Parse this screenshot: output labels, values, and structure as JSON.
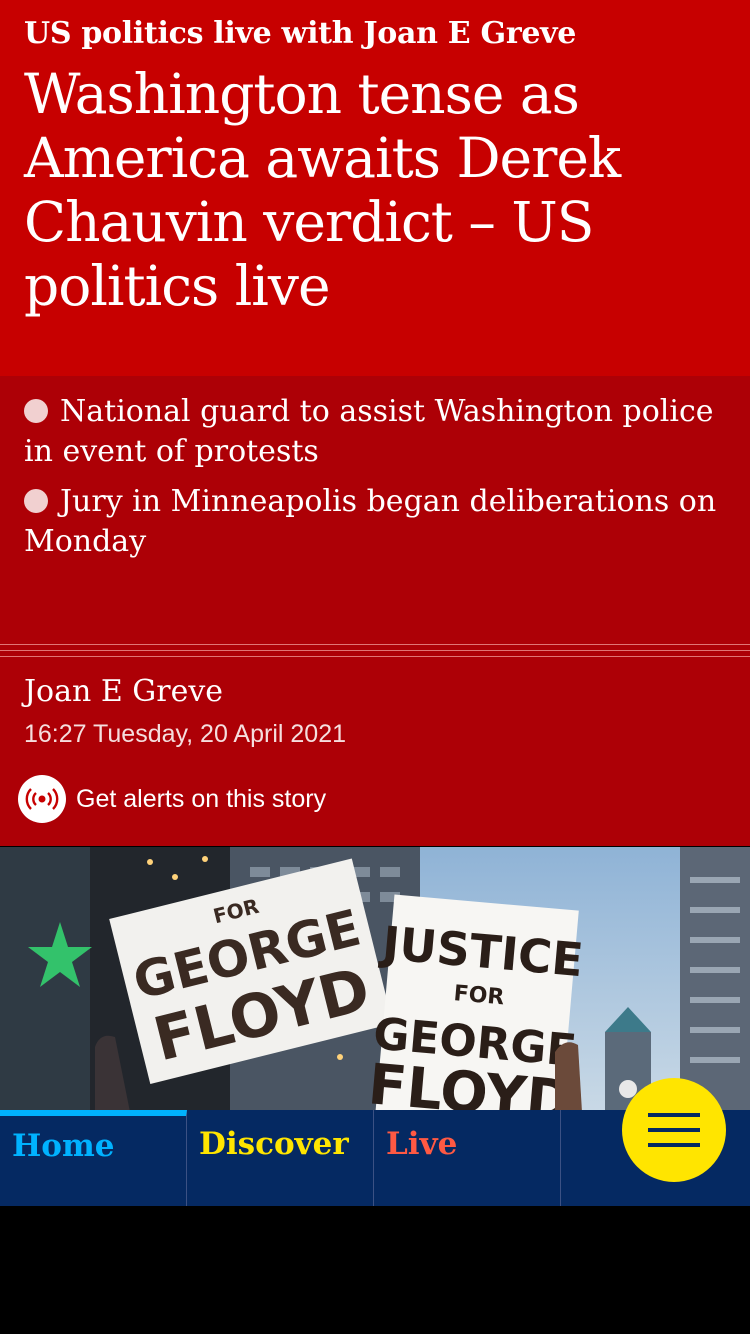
{
  "article": {
    "kicker": "US politics live with Joan E Greve",
    "headline": "Washington tense as America awaits Derek Chauvin verdict – US politics live",
    "bullets": [
      "National guard to assist Washington police in event of protests",
      "Jury in Minneapolis began deliberations on Monday"
    ],
    "byline": "Joan E Greve",
    "dateline": "16:27 Tuesday, 20 April 2021",
    "alerts_label": "Get alerts on this story"
  },
  "photo": {
    "sign_left_line1": "FOR",
    "sign_left_line2": "GEORGE",
    "sign_left_line3": "FLOYD",
    "sign_right_line1": "JUSTICE",
    "sign_right_line2": "FOR",
    "sign_right_line3": "GEORGE",
    "sign_right_line4": "FLOYD"
  },
  "nav": {
    "tabs": [
      {
        "label": "Home",
        "color": "#00b2ff"
      },
      {
        "label": "Discover",
        "color": "#ffe500"
      },
      {
        "label": "Live",
        "color": "#ff5943"
      }
    ],
    "menu_icon": "hamburger-icon"
  },
  "colors": {
    "header_bg": "#c70000",
    "standfirst_bg": "#ad0006",
    "nav_bg": "#052962",
    "menu_button": "#ffe500"
  }
}
